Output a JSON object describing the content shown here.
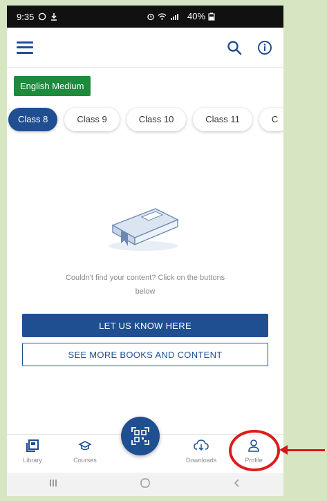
{
  "status_bar": {
    "time": "9:35",
    "battery": "40%"
  },
  "app_bar": {
    "menu_icon": "hamburger-icon",
    "search_icon": "search-icon",
    "info_icon": "info-icon"
  },
  "medium": {
    "label": "English Medium",
    "color": "#1d8a3c"
  },
  "class_tabs": [
    {
      "label": "Class 8",
      "active": true
    },
    {
      "label": "Class 9",
      "active": false
    },
    {
      "label": "Class 10",
      "active": false
    },
    {
      "label": "Class 11",
      "active": false
    },
    {
      "label": "C",
      "active": false
    }
  ],
  "empty_state": {
    "message": "Couldn't find your content? Click on the buttons below",
    "primary_button": "LET US KNOW HERE",
    "secondary_button": "SEE MORE BOOKS AND CONTENT"
  },
  "bottom_nav": {
    "items": [
      {
        "label": "Library",
        "icon": "library-icon"
      },
      {
        "label": "Courses",
        "icon": "courses-icon"
      },
      {
        "label": "Downloads",
        "icon": "download-icon"
      },
      {
        "label": "Profile",
        "icon": "profile-icon"
      }
    ],
    "center_icon": "qr-scan-icon"
  },
  "colors": {
    "primary": "#1f4f91",
    "highlight": "#e01a1a",
    "background": "#d6e6c2"
  }
}
